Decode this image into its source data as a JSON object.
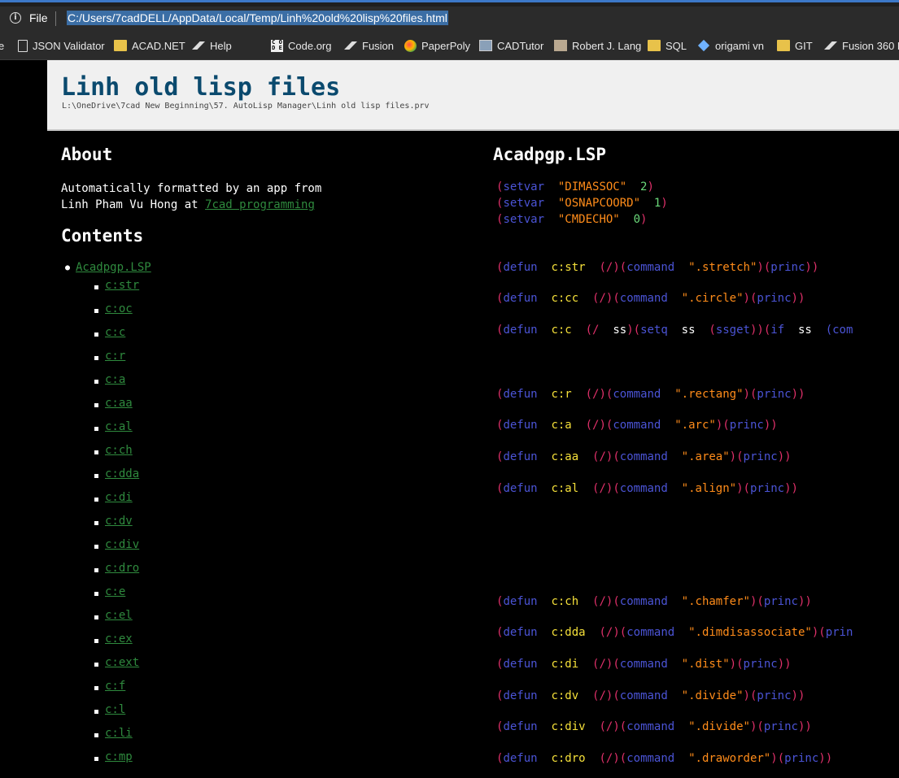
{
  "browser": {
    "file_label": "File",
    "url": "C:/Users/7cadDELL/AppData/Local/Temp/Linh%20old%20lisp%20files.html",
    "bookmarks": [
      {
        "label": "e",
        "icon": "none"
      },
      {
        "label": "JSON Validator",
        "icon": "page-icon"
      },
      {
        "label": "ACAD.NET",
        "icon": "folder-icon"
      },
      {
        "label": "Help",
        "icon": "fusion-icon"
      },
      {
        "label": "Code.org",
        "icon": "codeorg-icon"
      },
      {
        "label": "Fusion",
        "icon": "fusion-icon"
      },
      {
        "label": "PaperPoly",
        "icon": "paperpoly-icon"
      },
      {
        "label": "CADTutor",
        "icon": "cadtutor-icon"
      },
      {
        "label": "Robert J. Lang",
        "icon": "lang-icon"
      },
      {
        "label": "SQL",
        "icon": "folder-icon"
      },
      {
        "label": "origami vn",
        "icon": "origami-icon"
      },
      {
        "label": "GIT",
        "icon": "folder-icon"
      },
      {
        "label": "Fusion 360 H",
        "icon": "fusion-icon"
      }
    ]
  },
  "page": {
    "title": "Linh old lisp files",
    "path": "L:\\OneDrive\\7cad New Beginning\\57. AutoLisp Manager\\Linh old lisp files.prv",
    "about_heading": "About",
    "about_line1": "Automatically formatted by an app from",
    "about_line2_prefix": "Linh Pham Vu Hong at ",
    "about_link": "7cad programming",
    "contents_heading": "Contents",
    "toc_file": "Acadpgp.LSP",
    "toc_items": [
      "c:str",
      "c:oc",
      "c:c",
      "c:r",
      "c:a",
      "c:aa",
      "c:al",
      "c:ch",
      "c:dda",
      "c:di",
      "c:dv",
      "c:div",
      "c:dro",
      "c:e",
      "c:el",
      "c:ex",
      "c:ext",
      "c:f",
      "c:l",
      "c:li",
      "c:mp"
    ],
    "code_heading": "Acadpgp.LSP",
    "setvars": [
      {
        "kw": "setvar",
        "name": "\"DIMASSOC\"",
        "val": "2"
      },
      {
        "kw": "setvar",
        "name": "\"OSNAPCOORD\"",
        "val": "1"
      },
      {
        "kw": "setvar",
        "name": "\"CMDECHO\"",
        "val": "0"
      }
    ],
    "defuns": [
      {
        "name": "c:str",
        "cmd": "\".stretch\""
      },
      {
        "name": "c:cc",
        "cmd": "\".circle\""
      },
      {
        "name": "c:c",
        "special": true
      },
      {
        "name": "c:r",
        "cmd": "\".rectang\""
      },
      {
        "name": "c:a",
        "cmd": "\".arc\""
      },
      {
        "name": "c:aa",
        "cmd": "\".area\""
      },
      {
        "name": "c:al",
        "cmd": "\".align\""
      },
      {
        "name": "c:ch",
        "cmd": "\".chamfer\""
      },
      {
        "name": "c:dda",
        "cmd": "\".dimdisassociate\"",
        "cut": "(prin"
      },
      {
        "name": "c:di",
        "cmd": "\".dist\""
      },
      {
        "name": "c:dv",
        "cmd": "\".divide\""
      },
      {
        "name": "c:div",
        "cmd": "\".divide\""
      },
      {
        "name": "c:dro",
        "cmd": "\".draworder\""
      }
    ],
    "kw_defun": "defun",
    "kw_command": "command",
    "kw_princ": "princ",
    "c_line": {
      "args": "ss",
      "setq": "setq",
      "ssget": "ssget",
      "if": "if",
      "tail": "(com"
    }
  },
  "colors": {
    "paren": "#e0306a",
    "keyword": "#4b54d6",
    "function_name": "#f5e03a",
    "string": "#ff8c1a",
    "number": "#6bd97a",
    "link": "#2f8a3e",
    "title": "#0b4a6e"
  }
}
